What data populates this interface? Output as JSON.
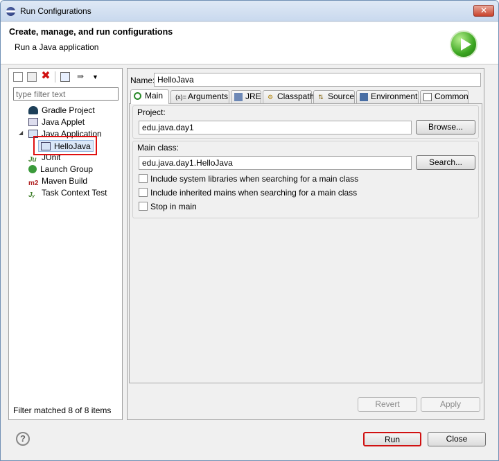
{
  "window": {
    "title": "Run Configurations"
  },
  "header": {
    "title": "Create, manage, and run configurations",
    "subtitle": "Run a Java application"
  },
  "left": {
    "filter_placeholder": "type filter text",
    "tree": [
      {
        "label": "Gradle Project",
        "icon": "gradle-icon"
      },
      {
        "label": "Java Applet",
        "icon": "applet-icon"
      },
      {
        "label": "Java Application",
        "icon": "java-app-icon",
        "expanded": true
      },
      {
        "label": "HelloJava",
        "icon": "java-config-icon",
        "selected": true
      },
      {
        "label": "JUnit",
        "icon": "junit-icon"
      },
      {
        "label": "Launch Group",
        "icon": "launch-group-icon"
      },
      {
        "label": "Maven Build",
        "icon": "maven-icon",
        "badge": "m2"
      },
      {
        "label": "Task Context Test",
        "icon": "task-context-icon"
      }
    ],
    "status": "Filter matched 8 of 8 items"
  },
  "right": {
    "name_label": "Name:",
    "name_value": "HelloJava",
    "tabs": [
      {
        "label": "Main",
        "icon": "main-icon",
        "active": true
      },
      {
        "label": "Arguments",
        "icon": "arguments-icon",
        "glyph": "(x)="
      },
      {
        "label": "JRE",
        "icon": "jre-icon"
      },
      {
        "label": "Classpath",
        "icon": "classpath-icon"
      },
      {
        "label": "Source",
        "icon": "source-icon"
      },
      {
        "label": "Environment",
        "icon": "environment-icon"
      },
      {
        "label": "Common",
        "icon": "common-icon"
      }
    ],
    "project": {
      "label": "Project:",
      "value": "edu.java.day1",
      "button": "Browse..."
    },
    "main_class": {
      "label": "Main class:",
      "value": "edu.java.day1.HelloJava",
      "button": "Search..."
    },
    "checks": [
      {
        "label": "Include system libraries when searching for a main class",
        "checked": false
      },
      {
        "label": "Include inherited mains when searching for a main class",
        "checked": false
      },
      {
        "label": "Stop in main",
        "checked": false
      }
    ],
    "revert": "Revert",
    "apply": "Apply"
  },
  "footer": {
    "run": "Run",
    "close": "Close"
  },
  "colors": {
    "highlight": "#e01010",
    "selection": "#dbe8f9",
    "run_icon": "#3aa51f"
  }
}
